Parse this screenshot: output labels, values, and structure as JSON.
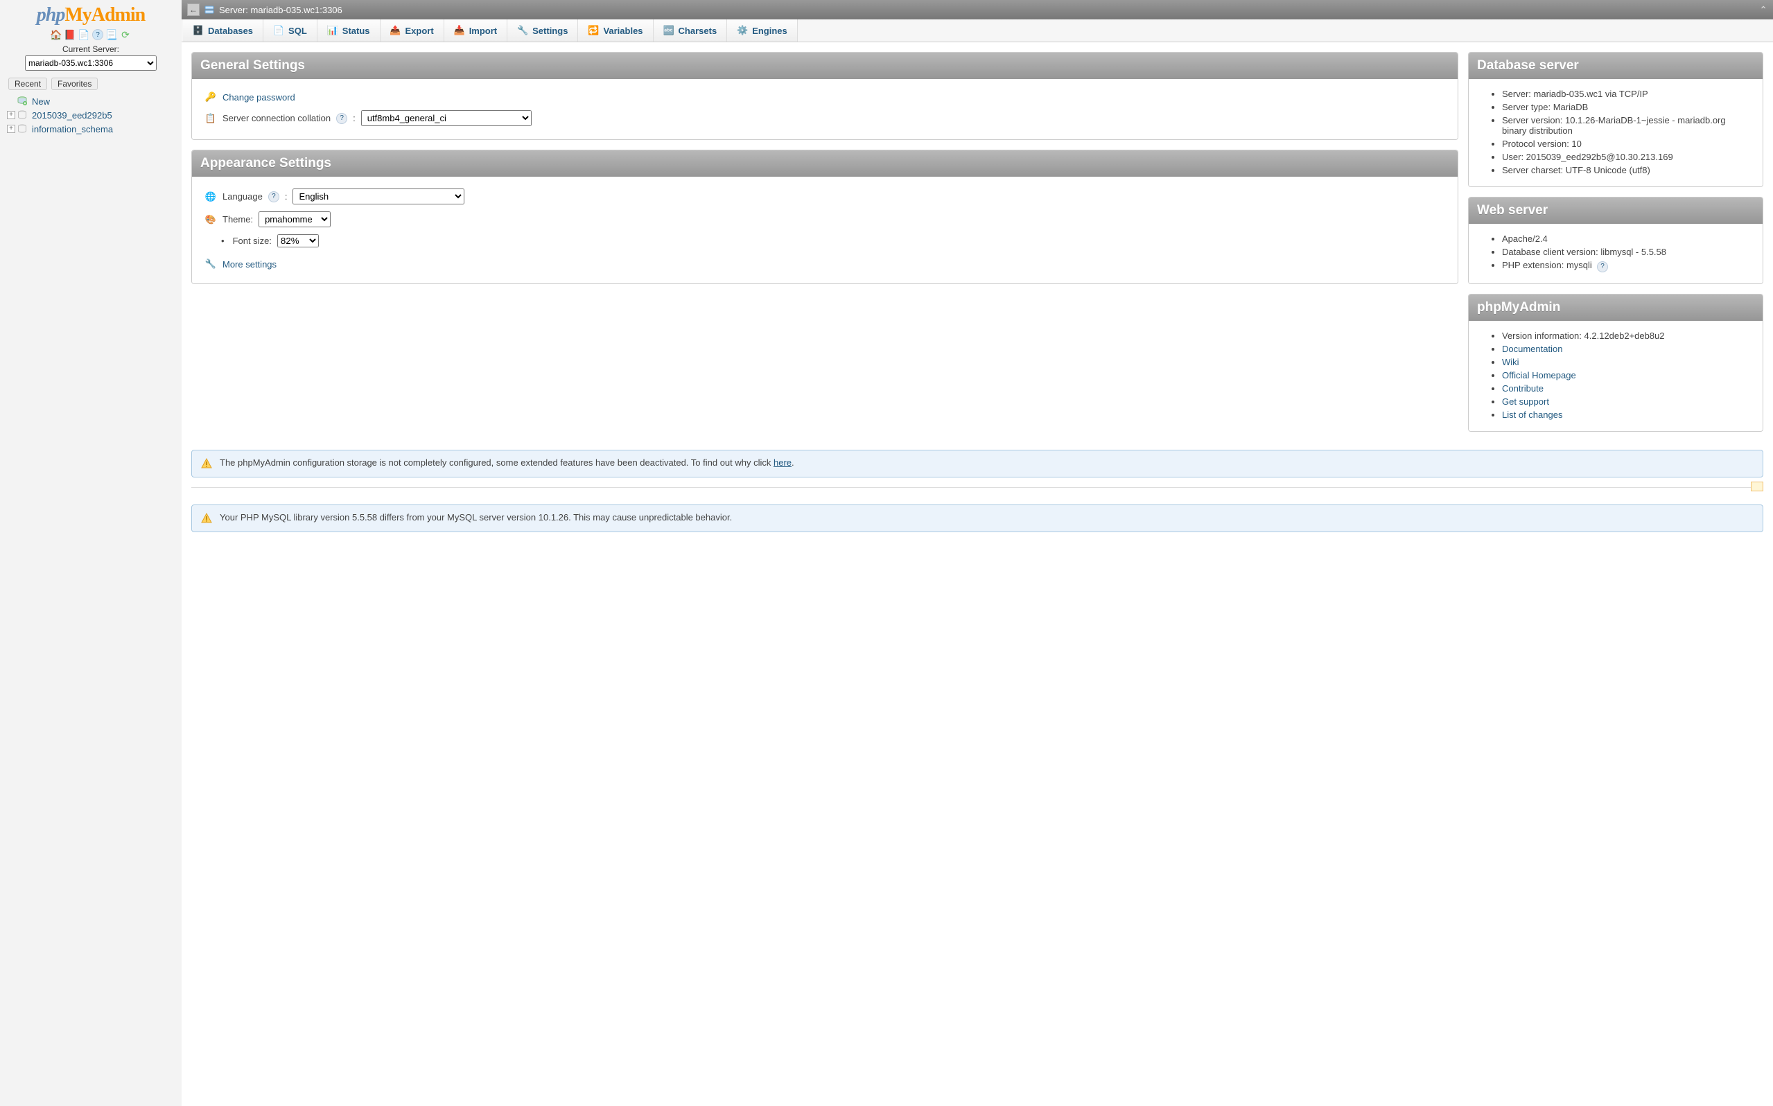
{
  "sidebar": {
    "current_server_label": "Current Server:",
    "server_options": [
      "mariadb-035.wc1:3306"
    ],
    "tabs": {
      "recent": "Recent",
      "favorites": "Favorites"
    },
    "tree": {
      "new": "New",
      "db1": "2015039_eed292b5",
      "db2": "information_schema"
    }
  },
  "topbar": {
    "server_path": "Server: mariadb-035.wc1:3306"
  },
  "tabs": {
    "databases": "Databases",
    "sql": "SQL",
    "status": "Status",
    "export": "Export",
    "import": "Import",
    "settings": "Settings",
    "variables": "Variables",
    "charsets": "Charsets",
    "engines": "Engines"
  },
  "general": {
    "title": "General Settings",
    "change_password": "Change password",
    "collation_label": "Server connection collation",
    "collation_value": "utf8mb4_general_ci"
  },
  "appearance": {
    "title": "Appearance Settings",
    "language_label": "Language",
    "language_value": "English",
    "theme_label": "Theme:",
    "theme_value": "pmahomme",
    "fontsize_label": "Font size:",
    "fontsize_value": "82%",
    "more_settings": "More settings"
  },
  "dbserver": {
    "title": "Database server",
    "server": "Server: mariadb-035.wc1 via TCP/IP",
    "server_type": "Server type: MariaDB",
    "server_version": "Server version: 10.1.26-MariaDB-1~jessie - mariadb.org binary distribution",
    "protocol": "Protocol version: 10",
    "user": "User: 2015039_eed292b5@10.30.213.169",
    "charset": "Server charset: UTF-8 Unicode (utf8)"
  },
  "webserver": {
    "title": "Web server",
    "apache": "Apache/2.4",
    "dbclient": "Database client version: libmysql - 5.5.58",
    "phpext": "PHP extension: mysqli"
  },
  "pma": {
    "title": "phpMyAdmin",
    "version": "Version information: 4.2.12deb2+deb8u2",
    "documentation": "Documentation",
    "wiki": "Wiki",
    "homepage": "Official Homepage",
    "contribute": "Contribute",
    "support": "Get support",
    "changes": "List of changes"
  },
  "notice1": {
    "text": "The phpMyAdmin configuration storage is not completely configured, some extended features have been deactivated. To find out why click ",
    "link": "here",
    "after": "."
  },
  "notice2": {
    "text": "Your PHP MySQL library version 5.5.58 differs from your MySQL server version 10.1.26. This may cause unpredictable behavior."
  }
}
